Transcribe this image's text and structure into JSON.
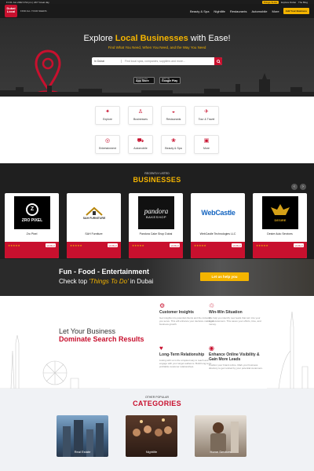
{
  "topbar": {
    "left": "Fri 01 Jun 2022 3:52 pm | 24/7 Great day",
    "links": [
      "Things To Do",
      "Explore Dubai",
      "The Blog"
    ]
  },
  "nav": {
    "logo_top": "Dubai",
    "logo_bottom": "Local",
    "tagline": "FIND ALL YOUR NEEDS",
    "menu": [
      "Beauty & Spa",
      "Nightlife",
      "Restaurants",
      "Automobile",
      "More"
    ],
    "cta": "Add Your Business"
  },
  "hero": {
    "title_pre": "Explore ",
    "title_em": "Local Businesses",
    "title_post": " with Ease!",
    "subtitle": "Find What You Need, When You Need, and the Way You Need",
    "location": "In Dubai",
    "search_placeholder": "Find local spas, companies, suppliers and more...",
    "app_store": "App Store",
    "google_play": "Google Play",
    "store_small_ios": "Download on the",
    "store_small_android": "GET IT ON"
  },
  "categories": [
    {
      "label": "Explore",
      "icon": "compass-icon",
      "glyph": "✦"
    },
    {
      "label": "Businesses",
      "icon": "person-icon",
      "glyph": "♙"
    },
    {
      "label": "Restaurants",
      "icon": "dish-icon",
      "glyph": "◒"
    },
    {
      "label": "Tour & Travel",
      "icon": "plane-icon",
      "glyph": "✈"
    },
    {
      "label": "Entertainment",
      "icon": "film-icon",
      "glyph": "◎"
    },
    {
      "label": "Automobile",
      "icon": "car-icon",
      "glyph": "⛟"
    },
    {
      "label": "Beauty & Spa",
      "icon": "spa-icon",
      "glyph": "❀"
    },
    {
      "label": "More",
      "icon": "grid-icon",
      "glyph": "▣"
    }
  ],
  "recent": {
    "small": "RECENTLY LISTED",
    "title": "BUSINESSES",
    "items": [
      {
        "name": "Zro Pixel",
        "logo": "ZRO PIXEL",
        "verified": "Verified"
      },
      {
        "name": "SAH Furniture",
        "logo": "SAH FURNITURE",
        "verified": "Verified"
      },
      {
        "name": "Pandora Cake Shop Dubai",
        "logo": "pandora",
        "logo_sub": "BAKESHOP",
        "verified": "Verified"
      },
      {
        "name": "WebCastle Technologies LLC",
        "logo": "WebCastle",
        "verified": "Verified"
      },
      {
        "name": "Desire Auto Services",
        "logo": "DESIRE",
        "verified": "Verified"
      }
    ],
    "stars": "★★★★★"
  },
  "fun": {
    "line1": "Fun - Food - Entertainment",
    "line2_pre": "Check top ",
    "line2_em": "'Things To Do'",
    "line2_post": " in Dubai",
    "button": "Let us help you"
  },
  "domination": {
    "heading1": "Let Your Business",
    "heading2": "Dominate Search Results",
    "features": [
      {
        "title": "Customer Insights",
        "desc": "Get insights into potential clients and the industry you serve. This will enhance your decision-making & business growth.",
        "icon": "insights-icon",
        "glyph": "⚙"
      },
      {
        "title": "Win-Win Situation",
        "desc": "We help you identify new leads that turn into your loyal customers. This saves your efforts, time, and money.",
        "icon": "handshake-icon",
        "glyph": "♲"
      },
      {
        "title": "Long-Term Relationship",
        "desc": "Listing with us is the simplest way to reach and engage with your target audience. Build long-term profitable customer relationships.",
        "icon": "heart-icon",
        "glyph": "♥"
      },
      {
        "title": "Enhance Online Visibility & Gain More Leads",
        "desc": "Position your brand online. Mark your business directory to get noticed by your potential customers.",
        "icon": "eye-icon",
        "glyph": "◉"
      }
    ]
  },
  "other": {
    "small": "OTHER POPULAR",
    "title": "CATEGORIES",
    "items": [
      {
        "label": "Real Estate"
      },
      {
        "label": "Nightlife"
      },
      {
        "label": "Home Services"
      }
    ]
  },
  "colors": {
    "red": "#c8102e",
    "yellow": "#f4b400",
    "dark": "#1f1f1f"
  }
}
